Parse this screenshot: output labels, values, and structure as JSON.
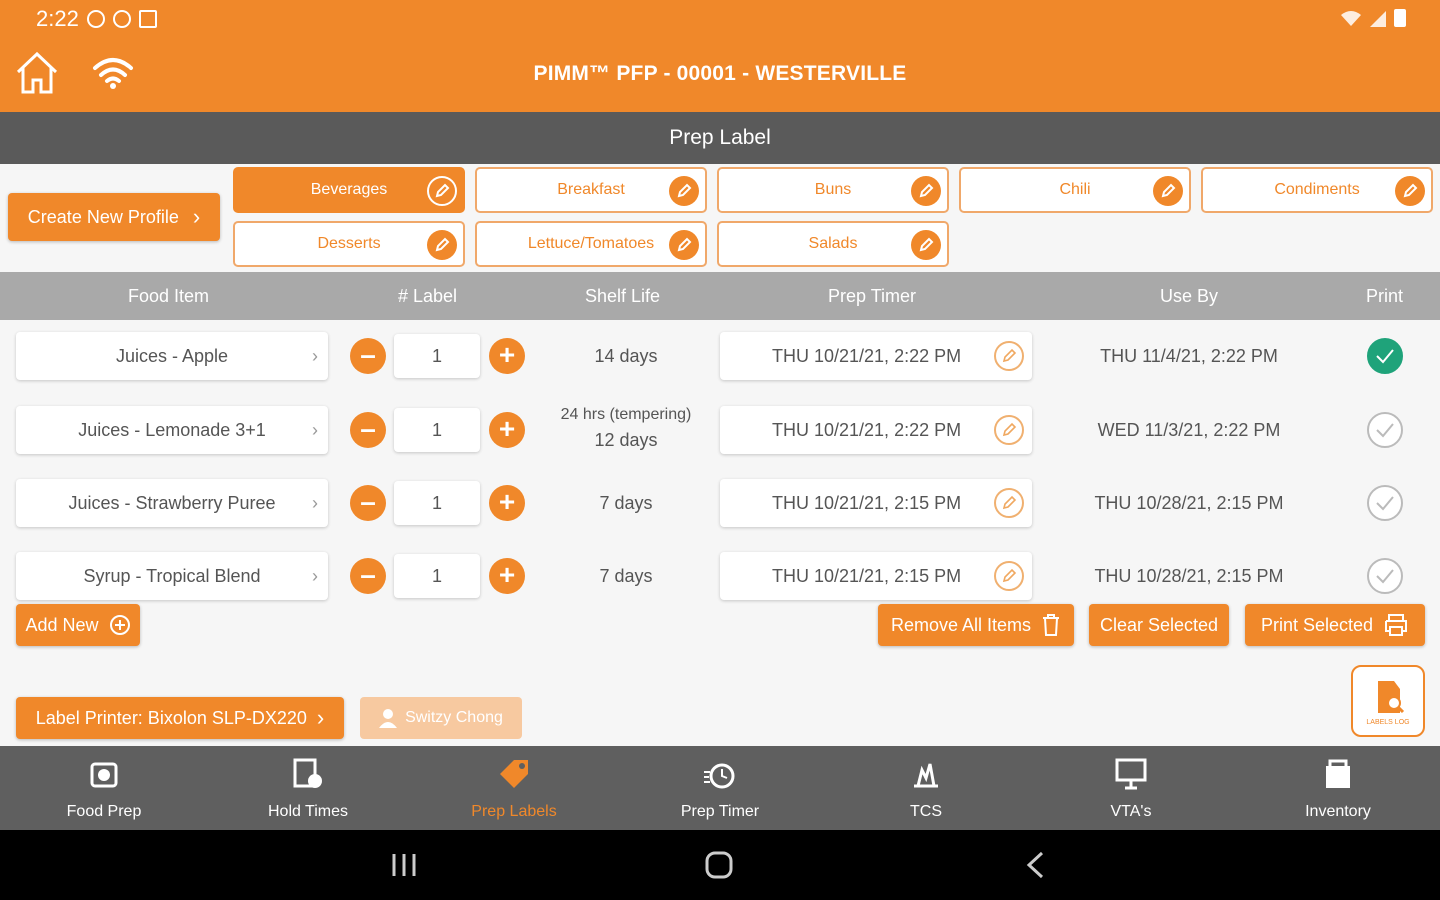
{
  "status_bar": {
    "time": "2:22"
  },
  "header": {
    "title": "PIMM™ PFP - 00001 - WESTERVILLE",
    "accent_color": "#f0882a"
  },
  "subheader": {
    "title": "Prep Label"
  },
  "profiles": {
    "create_label": "Create New Profile",
    "items": [
      {
        "label": "Beverages",
        "active": true
      },
      {
        "label": "Breakfast"
      },
      {
        "label": "Buns"
      },
      {
        "label": "Chili"
      },
      {
        "label": "Condiments"
      },
      {
        "label": "Desserts"
      },
      {
        "label": "Lettuce/Tomatoes"
      },
      {
        "label": "Salads"
      }
    ]
  },
  "table": {
    "headers": [
      "Food Item",
      "# Label",
      "Shelf Life",
      "Prep Timer",
      "Use By",
      "Print"
    ],
    "rows": [
      {
        "food": "Juices - Apple",
        "qty": "1",
        "shelf_line1": "14 days",
        "shelf_line2": "",
        "prep": "THU 10/21/21, 2:22 PM",
        "use_by": "THU 11/4/21, 2:22 PM",
        "selected": true
      },
      {
        "food": "Juices - Lemonade 3+1",
        "qty": "1",
        "shelf_line1": "24 hrs (tempering)",
        "shelf_line2": "12 days",
        "prep": "THU 10/21/21, 2:22 PM",
        "use_by": "WED 11/3/21, 2:22 PM",
        "selected": false
      },
      {
        "food": "Juices - Strawberry Puree",
        "qty": "1",
        "shelf_line1": "7 days",
        "shelf_line2": "",
        "prep": "THU 10/21/21, 2:15 PM",
        "use_by": "THU 10/28/21, 2:15 PM",
        "selected": false
      },
      {
        "food": "Syrup - Tropical Blend",
        "qty": "1",
        "shelf_line1": "7 days",
        "shelf_line2": "",
        "prep": "THU 10/21/21, 2:15 PM",
        "use_by": "THU 10/28/21, 2:15 PM",
        "selected": false
      }
    ]
  },
  "actions": {
    "add_new": "Add New",
    "remove_all": "Remove All Items",
    "clear_selected": "Clear Selected",
    "print_selected": "Print Selected",
    "label_printer": "Label Printer: Bixolon SLP-DX220",
    "user": "Switzy Chong",
    "labels_log": "LABELS LOG"
  },
  "nav": [
    {
      "label": "Food Prep",
      "icon": "food-prep-icon"
    },
    {
      "label": "Hold Times",
      "icon": "hold-times-icon"
    },
    {
      "label": "Prep Labels",
      "icon": "prep-labels-icon",
      "active": true
    },
    {
      "label": "Prep Timer",
      "icon": "prep-timer-icon"
    },
    {
      "label": "TCS",
      "icon": "tcs-icon"
    },
    {
      "label": "VTA's",
      "icon": "vta-icon"
    },
    {
      "label": "Inventory",
      "icon": "inventory-icon"
    }
  ]
}
